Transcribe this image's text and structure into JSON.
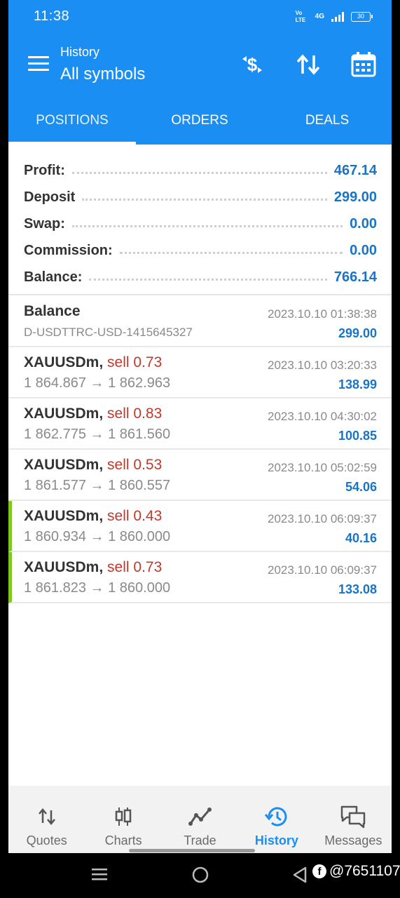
{
  "status_bar": {
    "time": "11:38",
    "net_label_1": "Vo LTE",
    "net_label_2": "4G",
    "battery": "30"
  },
  "header": {
    "subtitle": "History",
    "title": "All symbols",
    "icons": [
      "currency-exchange-icon",
      "sort-icon",
      "calendar-icon",
      "menu-icon"
    ],
    "accent_color": "#1a8ef2"
  },
  "tabs": [
    {
      "label": "POSITIONS",
      "active": true
    },
    {
      "label": "ORDERS",
      "active": false
    },
    {
      "label": "DEALS",
      "active": false
    }
  ],
  "summary": [
    {
      "label": "Profit:",
      "value": "467.14"
    },
    {
      "label": "Deposit",
      "value": "299.00"
    },
    {
      "label": "Swap:",
      "value": "0.00"
    },
    {
      "label": "Commission:",
      "value": "0.00"
    },
    {
      "label": "Balance:",
      "value": "766.14"
    }
  ],
  "deals": [
    {
      "symbol": "Balance",
      "type": "",
      "volume": "",
      "detail": "D-USDTTRC-USD-1415645327",
      "time": "2023.10.10 01:38:38",
      "profit": "299.00",
      "marked": false
    },
    {
      "symbol": "XAUUSDm,",
      "type": "sell",
      "volume": "0.73",
      "detail": "1 864.867 → 1 862.963",
      "time": "2023.10.10 03:20:33",
      "profit": "138.99",
      "marked": false
    },
    {
      "symbol": "XAUUSDm,",
      "type": "sell",
      "volume": "0.83",
      "detail": "1 862.775 → 1 861.560",
      "time": "2023.10.10 04:30:02",
      "profit": "100.85",
      "marked": false
    },
    {
      "symbol": "XAUUSDm,",
      "type": "sell",
      "volume": "0.53",
      "detail": "1 861.577 → 1 860.557",
      "time": "2023.10.10 05:02:59",
      "profit": "54.06",
      "marked": false
    },
    {
      "symbol": "XAUUSDm,",
      "type": "sell",
      "volume": "0.43",
      "detail": "1 860.934 → 1 860.000",
      "time": "2023.10.10 06:09:37",
      "profit": "40.16",
      "marked": true
    },
    {
      "symbol": "XAUUSDm,",
      "type": "sell",
      "volume": "0.73",
      "detail": "1 861.823 → 1 860.000",
      "time": "2023.10.10 06:09:37",
      "profit": "133.08",
      "marked": true
    }
  ],
  "bottom_nav": [
    {
      "label": "Quotes",
      "icon": "quotes-icon",
      "active": false
    },
    {
      "label": "Charts",
      "icon": "charts-icon",
      "active": false
    },
    {
      "label": "Trade",
      "icon": "trade-icon",
      "active": false
    },
    {
      "label": "History",
      "icon": "history-icon",
      "active": true
    },
    {
      "label": "Messages",
      "icon": "messages-icon",
      "active": false
    }
  ],
  "watermark": "@7651107",
  "colors": {
    "profit_blue": "#1a74c6",
    "sell_red": "#c0392b",
    "marker_green": "#7ec820"
  }
}
